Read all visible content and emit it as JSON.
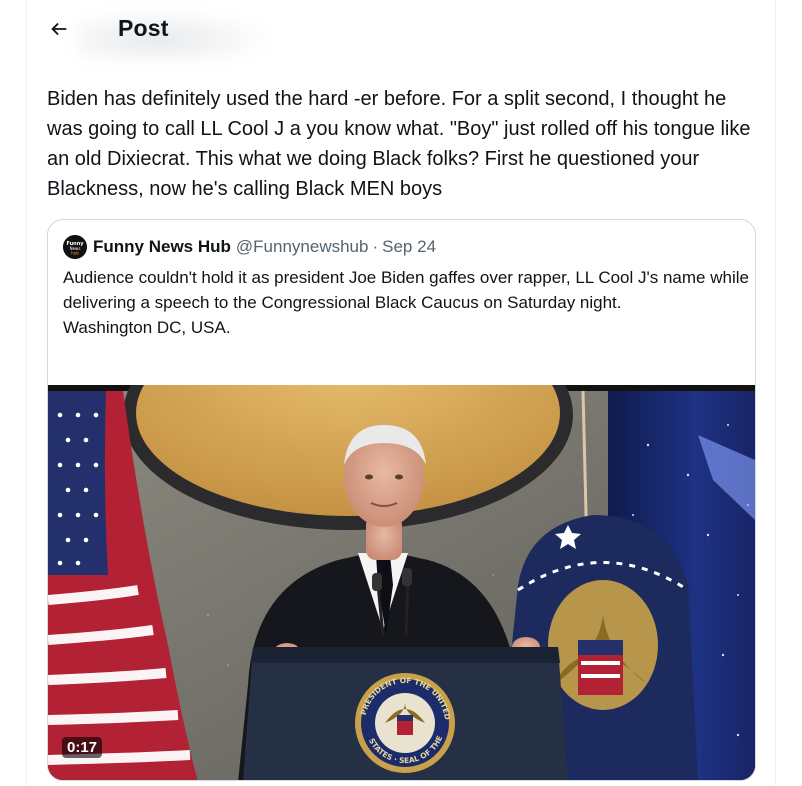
{
  "header": {
    "title": "Post",
    "back_icon": "arrow-left-icon"
  },
  "tweet": {
    "text": "Biden has definitely used the hard -er before. For a split second, I thought he was going to call LL Cool J a you know what. \"Boy\" just rolled off his tongue like an old Dixiecrat. This what we doing Black folks? First he questioned your Blackness, now he's calling Black MEN boys"
  },
  "quote": {
    "author_name": "Funny News Hub",
    "author_handle": "@Funnynewshub",
    "separator": "·",
    "date": "Sep 24",
    "avatar_text": "Funny News Hub",
    "lines": [
      "Audience couldn't hold it as president Joe Biden gaffes over rapper, LL Cool J's name while delivering a speech to the Congressional Black Caucus on Saturday night.",
      "Washington DC, USA."
    ],
    "video": {
      "duration": "0:17",
      "seal_text_top": "PRESIDENT OF THE UNITED",
      "seal_text_bottom": "STATES · SEAL OF THE",
      "colors": {
        "backdrop_gold": "#d7a95c",
        "backdrop_gray": "#7c7a72",
        "curtain_blue": "#1a2a6c",
        "podium_navy": "#263044"
      }
    }
  },
  "colors": {
    "text_primary": "#0f1419",
    "text_secondary": "#536471",
    "border": "#cfd9de"
  }
}
